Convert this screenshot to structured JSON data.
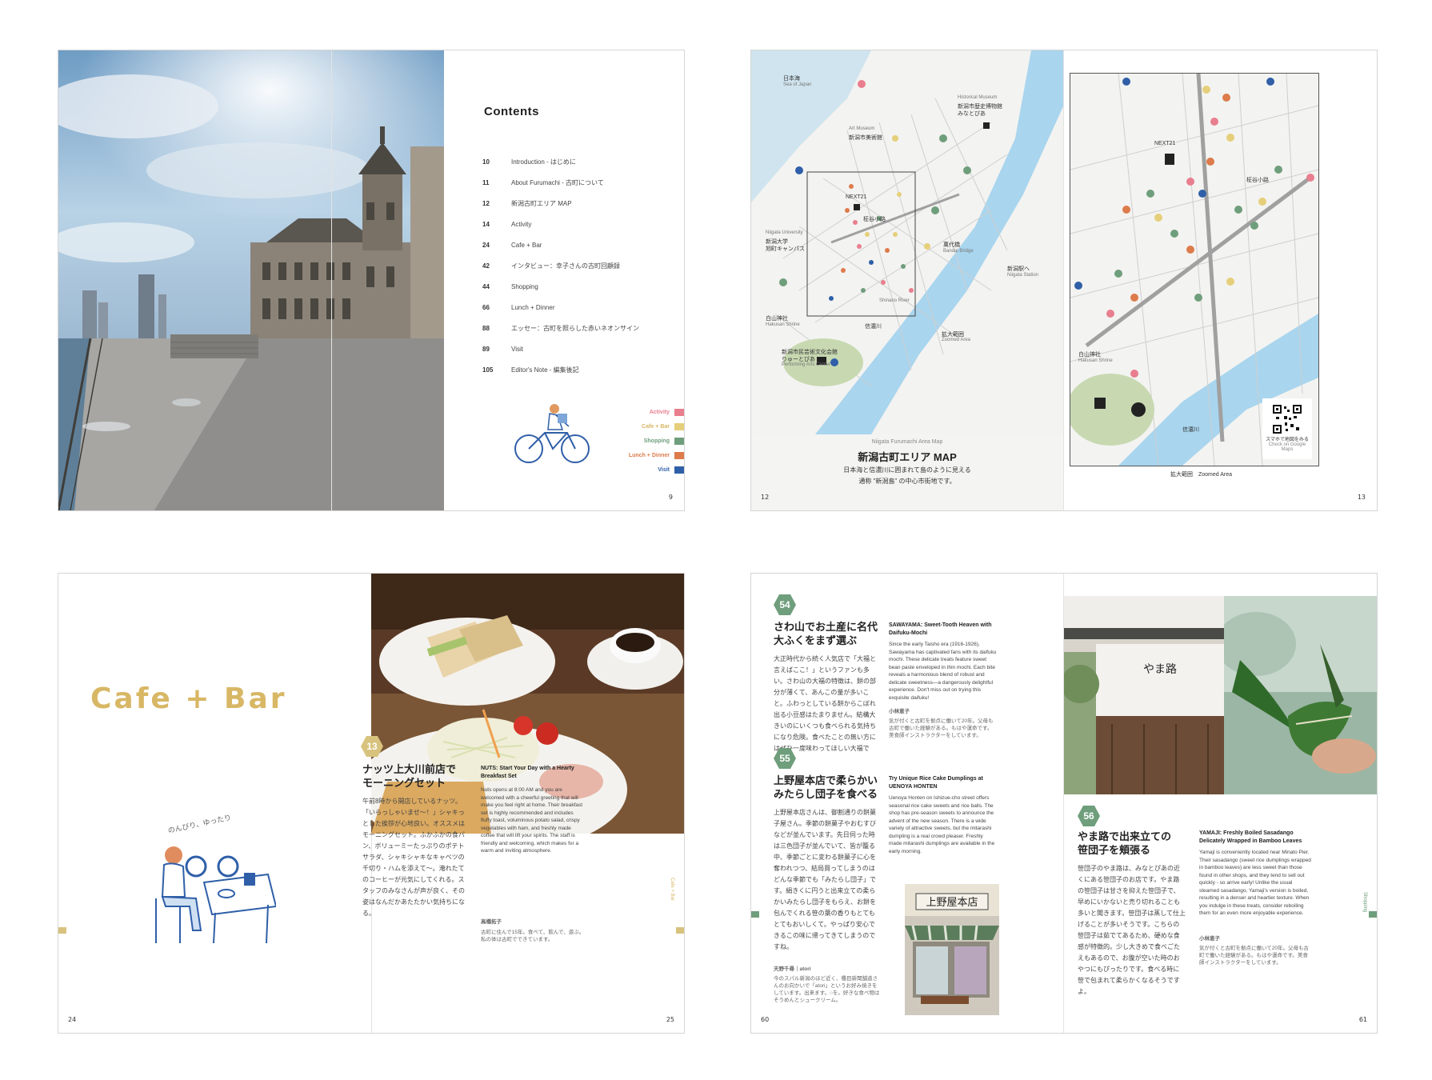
{
  "spread1": {
    "contents_title": "Contents",
    "toc": [
      {
        "num": "10",
        "title": "Introduction - はじめに"
      },
      {
        "num": "11",
        "title": "About Furumachi - 古町について"
      },
      {
        "num": "12",
        "title": "新潟古町エリア MAP"
      },
      {
        "num": "14",
        "title": "Activity"
      },
      {
        "num": "24",
        "title": "Cafe + Bar"
      },
      {
        "num": "42",
        "title": "インタビュー：幸子さんの古町回顧録"
      },
      {
        "num": "44",
        "title": "Shopping"
      },
      {
        "num": "66",
        "title": "Lunch + Dinner"
      },
      {
        "num": "88",
        "title": "エッセー：古町を照らした赤いネオンサイン"
      },
      {
        "num": "89",
        "title": "Visit"
      },
      {
        "num": "105",
        "title": "Editor's Note - 編集後記"
      }
    ],
    "legend": [
      {
        "label": "Activity",
        "color": "#e97e8e"
      },
      {
        "label": "Cafe + Bar",
        "color": "#e5cf7a"
      },
      {
        "label": "Shopping",
        "color": "#6f9e7c"
      },
      {
        "label": "Lunch + Dinner",
        "color": "#dd7b4b"
      },
      {
        "label": "Visit",
        "color": "#2f5fa8"
      }
    ],
    "page_number": "9"
  },
  "spread2": {
    "labels": {
      "sea_jp": "日本海",
      "sea_en": "Sea of Japan",
      "museum_en": "Historical Museum",
      "museum_jp": "新潟市歴史博物館",
      "museum_jp2": "みなとぴあ",
      "art_en": "Art Museum",
      "art_jp": "新潟市美術館",
      "next21": "NEXT21",
      "univ_en": "Niigata University",
      "univ_jp": "新潟大学",
      "univ_jp2": "旭町キャンパス",
      "shrine_jp": "白山神社",
      "shrine_en": "Hakusan Shrine",
      "river_jp": "信濃川",
      "river_en": "Shinano River",
      "bridge_jp": "萬代橋",
      "bridge_en": "Bandai Bridge",
      "station_jp": "新潟駅へ",
      "station_en": "Niigata Station",
      "arts_jp": "新潟市民芸術文化会館",
      "arts_jp2": "りゅーとぴあ",
      "arts_en": "Performing Arts Center",
      "zoom_jp": "拡大範囲",
      "zoom_en": "Zoomed Area",
      "street": "柾谷小路"
    },
    "caption_en": "Niigata Furumachi Area Map",
    "caption_title": "新潟古町エリア MAP",
    "caption_desc_1": "日本海と信濃川に囲まれて島のように見える",
    "caption_desc_2": "通称 \"新潟島\" の中心市街地です。",
    "qr_jp": "スマホで地図をみる",
    "qr_en": "Check on Google Maps",
    "zoom_caption": "拡大範囲　Zoomed Area",
    "page_left": "12",
    "page_right": "13"
  },
  "spread3": {
    "section_title": "Cafe + Bar",
    "tagline": "のんびり、ゆったり",
    "badge": "13",
    "jp_title_1": "ナッツ上大川前店で",
    "jp_title_2": "モーニングセット",
    "jp_body": "午前8時から開店しているナッツ。「いらっしゃいませ〜！」シャキっとした挨拶が心地良い。オススメはモーニングセット。ふかふかの食パン、ボリューミーたっぷりのポテトサラダ、シャキシャキなキャベツの千切り・ハムを添えて〜。淹れたてのコーヒーが元気にしてくれる。スタッフのみなさんが声が良く、その姿はなんだかあたたかい気持ちになる。",
    "en_title": "NUTS: Start Your Day with a Hearty Breakfast Set",
    "en_body": "Nuts opens at 8:00 AM and you are welcomed with a cheerful greeting that will make you feel right at home. Their breakfast set is highly recommended and includes fluffy toast, voluminous potato salad, crispy vegetables with ham, and freshly made coffee that will lift your spirits. The staff is friendly and welcoming, which makes for a warm and inviting atmosphere.",
    "author_name": "高橋拓子",
    "author_bio": "古町に住んで15年。食べて、飲んで、遊ぶ。私の体は古町でできています。",
    "side_label": "Cafe + Bar",
    "page_left": "24",
    "page_right": "25"
  },
  "spread4": {
    "item54": {
      "badge": "54",
      "jp_title_1": "さわ山でお土産に名代",
      "jp_title_2": "大ふくをまず選ぶ",
      "jp_body": "大正時代から続く人気店で「大福と言えばここ！」というファンも多い。さわ山の大福の特徴は、餅の部分が薄くて、あんこの量が多いこと。ふわっとしている餅からこぼれ出る小豆感はたまりません。結構大きいのにいくつも食べられる気持ちになり危険。食べたことの無い方にはぜひ一度味わってほしい大福です。",
      "en_title": "SAWAYAMA: Sweet-Tooth Heaven with Daifuku-Mochi",
      "en_body": "Since the early Taisho era (1916-1926), Sawayama has captivated fans with its daifuku mochi. These delicate treats feature sweet bean paste enveloped in thin mochi. Each bite reveals a harmonious blend of robust and delicate sweetness—a dangerously delightful experience. Don't miss out on trying this exquisite daifuku!",
      "author_name": "小林恵子",
      "author_bio": "気が付くと古町を拠点に働いて20年。父母も古町で働いた経験がある。もはや運命です。美食師インストラクターをしています。"
    },
    "item55": {
      "badge": "55",
      "jp_title_1": "上野屋本店で柔らかい",
      "jp_title_2": "みたらし団子を食べる",
      "jp_body": "上野屋本店さんは、御割通りの餅菓子屋さん。季節の餅菓子やおむすびなどが並んでいます。先日伺った時は三色団子が並んでいて、皆が籠る中、季節ごとに変わる餅菓子に心を奪われつつ、結局買ってしまうのはどんな季節でも「みたらし団子」です。絹きくに円うと出来立ての柔らかいみたらし団子をもらえ、お餅を包んでくれる笹の葉の香りもとてもとてもおいしくて。やっぱり安心できるこの味に帰ってきてしまうのですね。",
      "en_title": "Try Unique Rice Cake Dumplings at UENOYA HONTEN",
      "en_body": "Uenoya Honten on Ishizue-cho street offers seasonal rice cake sweets and rice balls. The shop has pre-season sweets to announce the advent of the new season. There is a wide variety of attractive sweets, but the mitarashi dumpling is a real crowd pleaser. Freshly made mitarashi dumplings are available in the early morning.",
      "author_name": "天野千尋｜atori",
      "author_bio": "今のスパル新潟のほど近く、種目新聞舗道さんのお向かいで「atori」というお好み焼きをしています。出来ます。○を。好きな食べ物はそうめんとシュークリーム。"
    },
    "item56": {
      "badge": "56",
      "jp_title_1": "やま路で出来立ての",
      "jp_title_2": "笹団子を頬張る",
      "jp_body": "笹団子のやま路は、みなとぴあの近くにある笹団子のお店です。やま路の笹団子は甘さを抑えた笹団子で、早めにいかないと売り切れることも多いと聞きます。笹団子は蒸して仕上げることが多いそうです。こちらの笹団子は茹でてあるため、硬めな食感が特徴的。少し大きめで食べごたえもあるので、お腹が空いた時のおやつにもぴったりです。食べる時に笹で包まれて柔らかくなるそうですよ。",
      "en_title": "YAMAJI: Freshly Boiled Sasadango Delicately Wrapped in Bamboo Leaves",
      "en_body": "Yamaji is conveniently located near Minato Pier. Their sasadango (sweet rice dumplings wrapped in bamboo leaves) are less sweet than those found in other shops, and they tend to sell out quickly - so arrive early! Unlike the usual steamed sasadango, Yamaji's version is boiled, resulting in a denser and heartier texture. When you indulge in these treats, consider reboiling them for an even more enjoyable experience.",
      "author_name": "小林恵子",
      "author_bio": "気が付くと古町を拠点に働いて20年。父母も古町で働いた経験がある。もはや運命です。美食師インストラクターをしています。"
    },
    "shop_sign": "上野屋本店",
    "noren_text": "やま路",
    "side_label": "Shopping",
    "page_left": "60",
    "page_right": "61"
  },
  "colors": {
    "cafe_yellow": "#d8b765",
    "shopping_green": "#6f9e7c",
    "ink_blue": "#2f5fa8"
  }
}
